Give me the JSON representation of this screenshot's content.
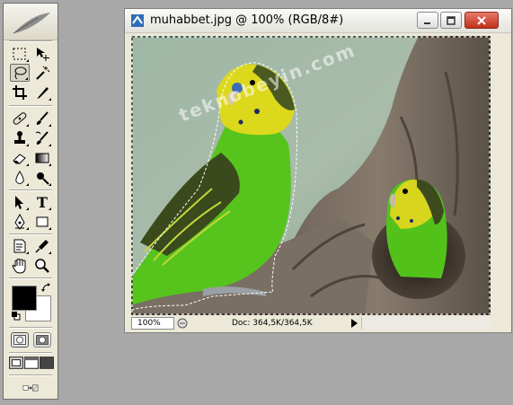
{
  "document": {
    "title": "muhabbet.jpg @ 100% (RGB/8#)",
    "zoom": "100%",
    "doc_info": "Doc: 364,5K/364,5K",
    "watermark": "teknobeyin.com"
  },
  "window_controls": [
    "minimize-button",
    "restore-button",
    "close-button"
  ],
  "toolbox": {
    "tools": [
      "rectangular-marquee-tool",
      "move-tool",
      "lasso-tool",
      "magic-wand-tool",
      "crop-tool",
      "slice-tool",
      "healing-brush-tool",
      "brush-tool",
      "clone-stamp-tool",
      "history-brush-tool",
      "eraser-tool",
      "gradient-tool",
      "blur-tool",
      "dodge-tool",
      "path-selection-tool",
      "type-tool",
      "pen-tool",
      "rectangle-tool",
      "notes-tool",
      "eyedropper-tool",
      "hand-tool",
      "zoom-tool"
    ],
    "selected_tool": "lasso-tool",
    "type_tool_label": "T",
    "foreground_color": "#000000",
    "background_color": "#ffffff"
  }
}
